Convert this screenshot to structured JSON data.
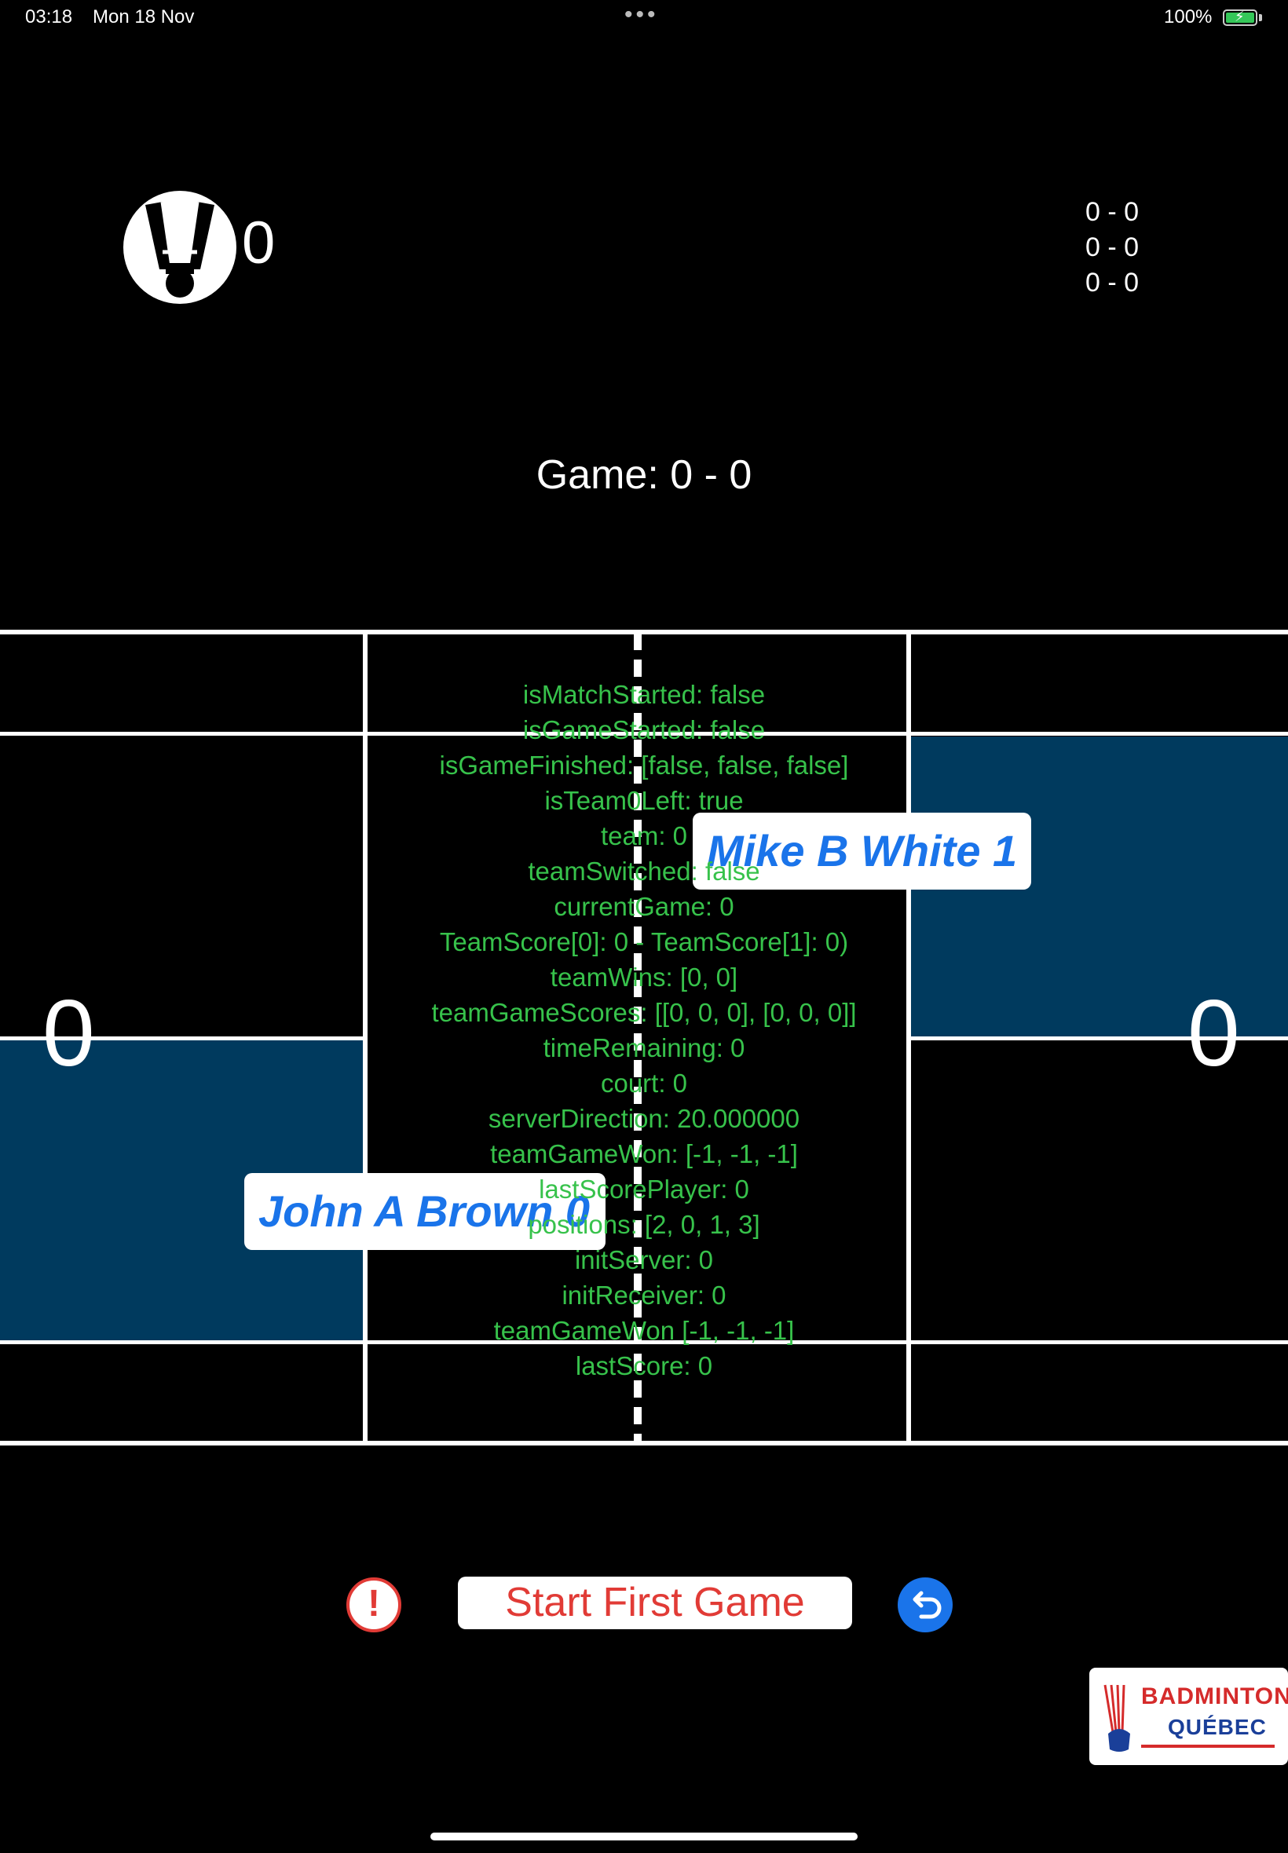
{
  "status_bar": {
    "time": "03:18",
    "date": "Mon 18 Nov",
    "dots": "•••",
    "battery": "100%"
  },
  "header": {
    "shuttle_score": "0",
    "game_scores": [
      "0 - 0",
      "0 - 0",
      "0 - 0"
    ],
    "game": "Game: 0 - 0"
  },
  "court": {
    "left_score": "0",
    "right_score": "0",
    "team_left_player": "John A Brown 0",
    "team_right_player": "Mike B White 1",
    "team_color": "#003a5e"
  },
  "debug": [
    "isMatchStarted: false",
    "isGameStarted: false",
    "isGameFinished: [false, false, false]",
    "isTeam0Left: true",
    "team: 0",
    "teamSwitched: false",
    "currentGame: 0",
    "TeamScore[0]: 0 - TeamScore[1]: 0)",
    "teamWins: [0, 0]",
    "teamGameScores: [[0, 0, 0], [0, 0, 0]]",
    "timeRemaining: 0",
    "court: 0",
    "serverDirection: 20.000000",
    "teamGameWon: [-1, -1, -1]",
    "lastScorePlayer: 0",
    "positions: [2, 0, 1, 3]",
    "initServer: 0",
    "initReceiver: 0",
    "teamGameWon [-1, -1, -1]",
    "lastScore: 0"
  ],
  "controls": {
    "alert_icon": "!",
    "start_label": "Start First Game"
  },
  "logo": {
    "line1": "BADMINTON",
    "line2": "QUÉBEC"
  },
  "colors": {
    "accent_red": "#e13b36",
    "accent_blue": "#1a74ea",
    "debug_green": "#37c24b"
  }
}
